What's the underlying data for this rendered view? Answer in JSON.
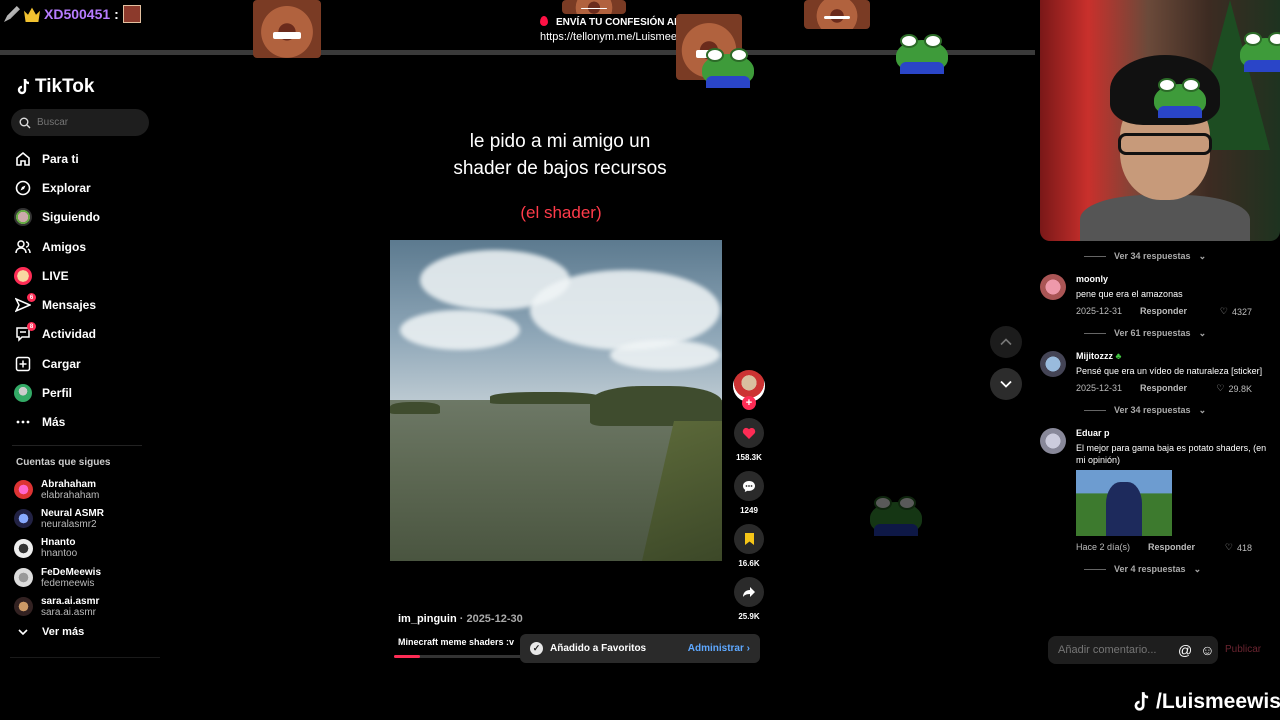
{
  "overlay": {
    "chat_user": "XD500451",
    "chat_colon": ":",
    "confession_title": "ENVÍA TU CONFESIÓN ANÓNIMA",
    "confession_url": "https://tellonym.me/Luismeewis",
    "watermark": "/Luismeewis"
  },
  "sidebar": {
    "logo": "TikTok",
    "search_placeholder": "Buscar",
    "nav": [
      {
        "label": "Para ti"
      },
      {
        "label": "Explorar"
      },
      {
        "label": "Siguiendo"
      },
      {
        "label": "Amigos"
      },
      {
        "label": "LIVE"
      },
      {
        "label": "Mensajes",
        "badge": "6"
      },
      {
        "label": "Actividad",
        "badge": "8"
      },
      {
        "label": "Cargar"
      },
      {
        "label": "Perfil"
      },
      {
        "label": "Más"
      }
    ],
    "following_title": "Cuentas que sigues",
    "following": [
      {
        "name": "Abrahaham",
        "handle": "elabrahaham"
      },
      {
        "name": "Neural ASMR",
        "handle": "neuralasmr2"
      },
      {
        "name": "Hnanto",
        "handle": "hnantoo"
      },
      {
        "name": "FeDeMeewis",
        "handle": "fedemeewis"
      },
      {
        "name": "sara.ai.asmr",
        "handle": "sara.ai.asmr"
      }
    ],
    "see_more": "Ver más"
  },
  "video": {
    "caption_line1": "le pido a mi amigo un",
    "caption_line2": "shader de bajos recursos",
    "caption_red": "(el shader)",
    "author": "im_pinguin",
    "date": "· 2025-12-30",
    "description": "Minecraft meme shaders :v",
    "likes": "158.3K",
    "comments": "1249",
    "saves": "16.6K",
    "shares": "25.9K",
    "progress": 0.2
  },
  "toast": {
    "text": "Añadido a Favoritos",
    "action": "Administrar"
  },
  "comments": {
    "items": [
      {
        "replies_before": "Ver 34 respuestas",
        "user": "moonly",
        "text": "pene que era el amazonas",
        "date": "2025-12-31",
        "reply": "Responder",
        "likes": "4327"
      },
      {
        "replies_before": "Ver 61 respuestas",
        "user": "Mijitozzz",
        "text": "Pensé que era un vídeo de naturaleza [sticker]",
        "date": "2025-12-31",
        "reply": "Responder",
        "likes": "29.8K"
      },
      {
        "replies_before": "Ver 34 respuestas",
        "user": "Eduar p",
        "text": "El mejor para gama baja es potato shaders, (en mi opinión)",
        "date": "Hace 2 día(s)",
        "reply": "Responder",
        "likes": "418"
      }
    ],
    "last_replies": "Ver 4 respuestas",
    "input_placeholder": "Añadir comentario...",
    "publish": "Publicar"
  },
  "colors": {
    "accent": "#fe2c55",
    "username_chat": "#b77cff",
    "link": "#5ea8ff"
  }
}
